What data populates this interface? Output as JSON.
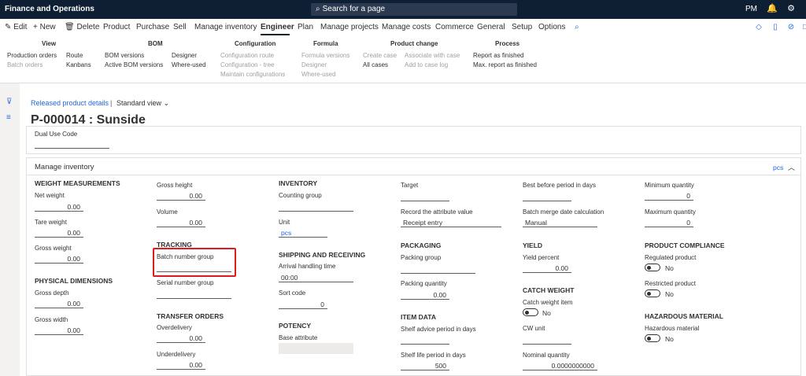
{
  "app": {
    "title": "Finance and Operations",
    "search_placeholder": "Search for a page",
    "user_initials": "PM"
  },
  "toolbar": {
    "edit": "Edit",
    "new": "New",
    "delete": "Delete",
    "tabs": [
      "Product",
      "Purchase",
      "Sell",
      "Manage inventory",
      "Engineer",
      "Plan",
      "Manage projects",
      "Manage costs",
      "Commerce",
      "General",
      "Setup",
      "Options"
    ],
    "active_tab": "Engineer"
  },
  "ribbon": {
    "view": {
      "title": "View",
      "production_orders": "Production orders",
      "batch_orders": "Batch orders",
      "route": "Route",
      "kanbans": "Kanbans"
    },
    "bom": {
      "title": "BOM",
      "bom_versions": "BOM versions",
      "active_bom_versions": "Active BOM versions",
      "designer": "Designer",
      "where_used": "Where-used"
    },
    "configuration": {
      "title": "Configuration",
      "configuration_route": "Configuration route",
      "configuration_tree": "Configuration - tree",
      "maintain_configurations": "Maintain configurations"
    },
    "formula": {
      "title": "Formula",
      "formula_versions": "Formula versions",
      "designer": "Designer",
      "where_used": "Where-used"
    },
    "product_change": {
      "title": "Product change",
      "create_case": "Create case",
      "all_cases": "All cases",
      "associate_with_case": "Associate with case",
      "add_to_case_log": "Add to case log"
    },
    "process": {
      "title": "Process",
      "report_as_finished": "Report as finished",
      "max_report_as_finished": "Max. report as finished"
    }
  },
  "page": {
    "breadcrumb": "Released product details",
    "separator": "|",
    "view": "Standard view",
    "title": "P-000014 : Sunside"
  },
  "dual_use": {
    "label": "Dual Use Code"
  },
  "manage_inventory": {
    "title": "Manage inventory",
    "unit_link": "pcs",
    "weight_measurements": "WEIGHT MEASUREMENTS",
    "net_weight": {
      "label": "Net weight",
      "value": "0.00"
    },
    "tare_weight": {
      "label": "Tare weight",
      "value": "0.00"
    },
    "gross_weight": {
      "label": "Gross weight",
      "value": "0.00"
    },
    "physical_dimensions": "PHYSICAL DIMENSIONS",
    "gross_depth": {
      "label": "Gross depth",
      "value": "0.00"
    },
    "gross_width": {
      "label": "Gross width",
      "value": "0.00"
    },
    "gross_height": {
      "label": "Gross height",
      "value": "0.00"
    },
    "volume": {
      "label": "Volume",
      "value": "0.00"
    },
    "tracking": "TRACKING",
    "batch_number_group": {
      "label": "Batch number group",
      "value": ""
    },
    "serial_number_group": {
      "label": "Serial number group",
      "value": ""
    },
    "transfer_orders": "TRANSFER ORDERS",
    "overdelivery": {
      "label": "Overdelivery",
      "value": "0.00"
    },
    "underdelivery": {
      "label": "Underdelivery",
      "value": "0.00"
    },
    "inventory": "INVENTORY",
    "counting_group": {
      "label": "Counting group",
      "value": ""
    },
    "unit": {
      "label": "Unit",
      "value": "pcs"
    },
    "shipping_receiving": "SHIPPING AND RECEIVING",
    "arrival_handling_time": {
      "label": "Arrival handling time",
      "value": "00:00"
    },
    "sort_code": {
      "label": "Sort code",
      "value": "0"
    },
    "potency": "POTENCY",
    "base_attribute": {
      "label": "Base attribute",
      "value": ""
    },
    "target": {
      "label": "Target",
      "value": ""
    },
    "record_attribute": {
      "label": "Record the attribute value",
      "value": "Receipt entry"
    },
    "packaging": "PACKAGING",
    "packing_group": {
      "label": "Packing group",
      "value": ""
    },
    "packing_quantity": {
      "label": "Packing quantity",
      "value": "0.00"
    },
    "item_data": "ITEM DATA",
    "shelf_advice": {
      "label": "Shelf advice period in days",
      "value": ""
    },
    "shelf_life": {
      "label": "Shelf life period in days",
      "value": "500"
    },
    "best_before": {
      "label": "Best before period in days",
      "value": ""
    },
    "batch_merge": {
      "label": "Batch merge date calculation",
      "value": "Manual"
    },
    "yield": "YIELD",
    "yield_percent": {
      "label": "Yield percent",
      "value": "0.00"
    },
    "catch_weight": "CATCH WEIGHT",
    "catch_weight_item": {
      "label": "Catch weight item",
      "value": "No"
    },
    "cw_unit": {
      "label": "CW unit",
      "value": ""
    },
    "nominal_quantity": {
      "label": "Nominal quantity",
      "value": "0.0000000000"
    },
    "minimum_quantity": {
      "label": "Minimum quantity",
      "value": "0"
    },
    "maximum_quantity": {
      "label": "Maximum quantity",
      "value": "0"
    },
    "product_compliance": "PRODUCT COMPLIANCE",
    "regulated_product": {
      "label": "Regulated product",
      "value": "No"
    },
    "restricted_product": {
      "label": "Restricted product",
      "value": "No"
    },
    "hazardous_material_hdr": "HAZARDOUS MATERIAL",
    "hazardous_material": {
      "label": "Hazardous material",
      "value": "No"
    }
  }
}
